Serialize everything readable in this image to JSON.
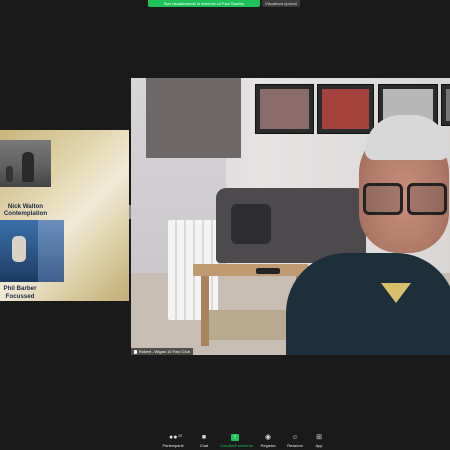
{
  "banner": {
    "sharing_text": "Stai visualizzando lo schermo di Paul Stanley",
    "view_options": "Visualizza opzioni"
  },
  "shared_screen": {
    "photo1_caption_name": "Nick Walton",
    "photo1_caption_title": "Contemplation",
    "photo2_caption_name": "Phil Barber",
    "photo2_caption_title": "Focussed"
  },
  "video": {
    "participant_name": "Robert - Wigan 10 Foto Club"
  },
  "toolbar": {
    "participants_label": "Partecipanti",
    "participants_count": "28",
    "chat_label": "Chat",
    "share_label": "Condividi schermo",
    "record_label": "Registra",
    "reactions_label": "Reazioni",
    "apps_label": "App"
  },
  "colors": {
    "accent": "#1dc25b",
    "background": "#1a1a1a"
  }
}
